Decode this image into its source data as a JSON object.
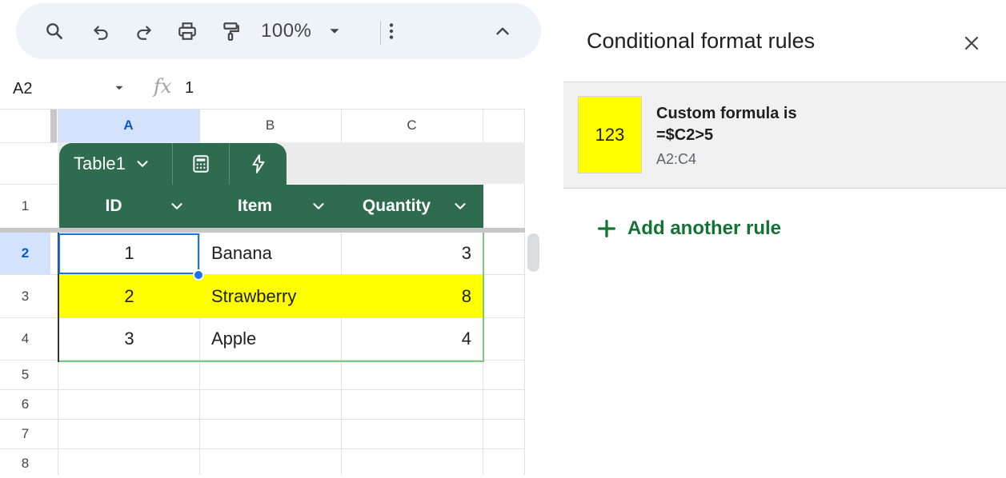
{
  "toolbar": {
    "zoom": "100%",
    "icons": [
      "search-icon",
      "undo-icon",
      "redo-icon",
      "print-icon",
      "paint-format-icon",
      "chevron-down-icon",
      "more-vert-icon",
      "chevron-up-icon"
    ]
  },
  "formula_bar": {
    "name_box": "A2",
    "fx": "fx",
    "value": "1"
  },
  "grid": {
    "columns": [
      "A",
      "B",
      "C"
    ],
    "rows": [
      "1",
      "2",
      "3",
      "4",
      "5",
      "6",
      "7",
      "8"
    ],
    "selected_column": "A",
    "selected_row": "2"
  },
  "table": {
    "name": "Table1",
    "headers": [
      "ID",
      "Item",
      "Quantity"
    ],
    "rows": [
      [
        "1",
        "Banana",
        "3"
      ],
      [
        "2",
        "Strawberry",
        "8"
      ],
      [
        "3",
        "Apple",
        "4"
      ]
    ],
    "highlight_color": "#ffff00",
    "header_color": "#2e6b4f"
  },
  "panel": {
    "title": "Conditional format rules",
    "rule": {
      "preview": "123",
      "condition_line1": "Custom formula is",
      "condition_line2": "=$C2>5",
      "range": "A2:C4",
      "preview_color": "#ffff00"
    },
    "add_rule": "Add another rule",
    "accent": "#137333"
  }
}
